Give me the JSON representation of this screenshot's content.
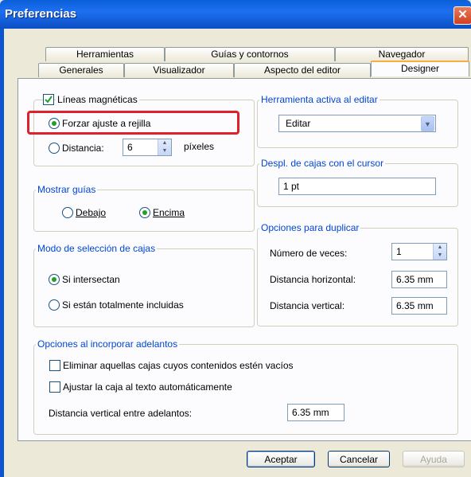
{
  "window": {
    "title": "Preferencias",
    "close_glyph": "✕"
  },
  "tabs": {
    "row1": [
      "Herramientas",
      "Guías y contornos",
      "Navegador"
    ],
    "row2": [
      "Generales",
      "Visualizador",
      "Aspecto del editor",
      "Designer"
    ],
    "active": "Designer"
  },
  "magnetic": {
    "title": "Líneas magnéticas",
    "checked": true,
    "snap_grid_label": "Forzar ajuste a rejilla",
    "distance_label": "Distancia:",
    "distance_value": "6",
    "pixels_label": "píxeles"
  },
  "guides": {
    "title": "Mostrar guías",
    "below": "Debajo",
    "above": "Encima",
    "selected": "Encima"
  },
  "selection_mode": {
    "title": "Modo de selección de cajas",
    "intersect": "Si intersectan",
    "fully": "Si están totalmente incluidas",
    "selected": "Si intersectan"
  },
  "active_tool": {
    "title": "Herramienta activa al editar",
    "value": "Editar"
  },
  "cursor_move": {
    "title": "Despl. de cajas con el cursor",
    "value": "1 pt"
  },
  "duplicate": {
    "title": "Opciones para duplicar",
    "times_label": "Número de veces:",
    "times_value": "1",
    "hdist_label": "Distancia horizontal:",
    "hdist_value": "6.35 mm",
    "vdist_label": "Distancia vertical:",
    "vdist_value": "6.35 mm"
  },
  "advance": {
    "title": "Opciones al incorporar adelantos",
    "remove_empty": "Eliminar aquellas cajas cuyos contenidos estén vacíos",
    "fit_text": "Ajustar la caja al texto automáticamente",
    "vdist_label": "Distancia vertical entre adelantos:",
    "vdist_value": "6.35 mm"
  },
  "buttons": {
    "accept": "Aceptar",
    "cancel": "Cancelar",
    "help": "Ayuda"
  },
  "colors": {
    "highlight": "#e0202a",
    "title_bar": "#0a5fd8",
    "group_label": "#0046d5"
  }
}
